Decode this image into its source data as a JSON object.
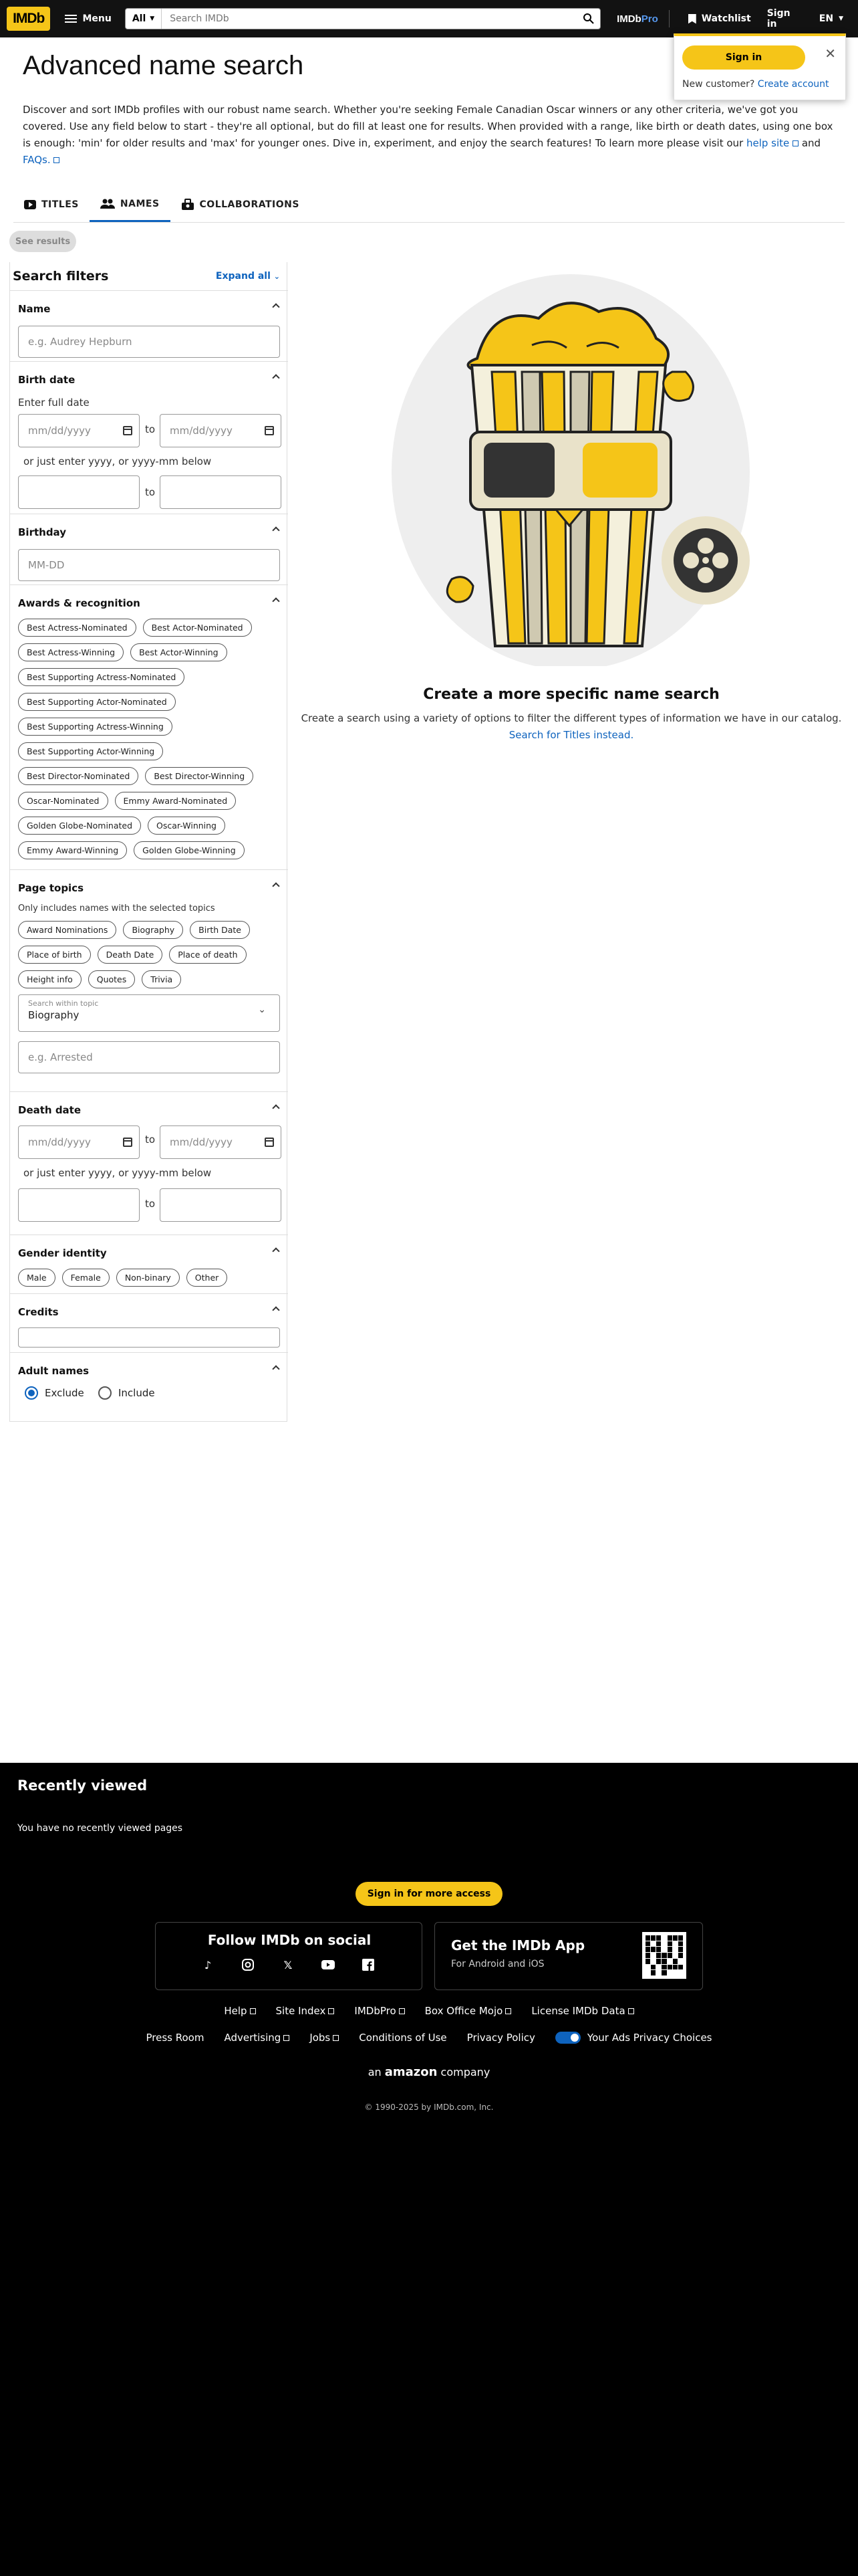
{
  "topbar": {
    "logo": "IMDb",
    "menu_label": "Menu",
    "search_category": "All",
    "search_placeholder": "Search IMDb",
    "pro_a": "IMDb",
    "pro_b": "Pro",
    "watchlist": "Watchlist",
    "signin": "Sign in",
    "language": "EN"
  },
  "popover": {
    "signin_button": "Sign in",
    "new_customer": "New customer?",
    "create_account": "Create account"
  },
  "page": {
    "title": "Advanced name search",
    "intro": "Discover and sort IMDb profiles with our robust name search. Whether you're seeking Female Canadian Oscar winners or any other criteria, we've got you covered. Use any field below to start - they're all optional, but do fill at least one for results. When provided with a range, like birth or death dates, using one box is enough: 'min' for older results and 'max' for younger ones. Dive in, experiment, and enjoy the search features! To learn more please visit our ",
    "help_link": "help site",
    "and": " and ",
    "faqs_link": "FAQs.",
    "see_results": "See results"
  },
  "tabs": [
    {
      "label": "TITLES",
      "icon": "movie-icon"
    },
    {
      "label": "NAMES",
      "icon": "people-icon"
    },
    {
      "label": "COLLABORATIONS",
      "icon": "collaboration-icon"
    }
  ],
  "filters": {
    "heading": "Search filters",
    "expand_all": "Expand all",
    "name": {
      "title": "Name",
      "placeholder": "e.g. Audrey Hepburn"
    },
    "birth_date": {
      "title": "Birth date",
      "enter_full": "Enter full date",
      "date_placeholder": "mm/dd/yyyy",
      "to": "to",
      "or_just": "or just enter yyyy, or yyyy-mm below"
    },
    "birthday": {
      "title": "Birthday",
      "placeholder": "MM-DD"
    },
    "awards": {
      "title": "Awards & recognition",
      "chips": [
        "Best Actress-Nominated",
        "Best Actor-Nominated",
        "Best Actress-Winning",
        "Best Actor-Winning",
        "Best Supporting Actress-Nominated",
        "Best Supporting Actor-Nominated",
        "Best Supporting Actress-Winning",
        "Best Supporting Actor-Winning",
        "Best Director-Nominated",
        "Best Director-Winning",
        "Oscar-Nominated",
        "Emmy Award-Nominated",
        "Golden Globe-Nominated",
        "Oscar-Winning",
        "Emmy Award-Winning",
        "Golden Globe-Winning"
      ]
    },
    "page_topics": {
      "title": "Page topics",
      "note": "Only includes names with the selected topics",
      "chips": [
        "Award Nominations",
        "Biography",
        "Birth Date",
        "Place of birth",
        "Death Date",
        "Place of death",
        "Height info",
        "Quotes",
        "Trivia"
      ],
      "select_label": "Search within topic",
      "select_value": "Biography",
      "text_placeholder": "e.g. Arrested"
    },
    "death_date": {
      "title": "Death date",
      "date_placeholder": "mm/dd/yyyy",
      "to": "to",
      "or_just": "or just enter yyyy, or yyyy-mm below"
    },
    "gender": {
      "title": "Gender identity",
      "chips": [
        "Male",
        "Female",
        "Non-binary",
        "Other"
      ]
    },
    "credits": {
      "title": "Credits"
    },
    "adult": {
      "title": "Adult names",
      "exclude": "Exclude",
      "include": "Include"
    }
  },
  "hero": {
    "title": "Create a more specific name search",
    "subtitle": "Create a search using a variety of options to filter the different types of information we have in our catalog.",
    "link": "Search for Titles instead."
  },
  "footer": {
    "recently_viewed": "Recently viewed",
    "no_recent": "You have no recently viewed pages",
    "signin_more": "Sign in for more access",
    "follow": "Follow IMDb on social",
    "app_title": "Get the IMDb App",
    "app_sub": "For Android and iOS",
    "links1": [
      "Help",
      "Site Index",
      "IMDbPro",
      "Box Office Mojo",
      "License IMDb Data"
    ],
    "links2": [
      "Press Room",
      "Advertising",
      "Jobs",
      "Conditions of Use",
      "Privacy Policy",
      "Your Ads Privacy Choices"
    ],
    "an": "an",
    "amazon": "amazon",
    "company": "company",
    "copyright": "© 1990-2025 by IMDb.com, Inc."
  },
  "colors": {
    "brand": "#f5c518",
    "link": "#0e63be",
    "footer_bg": "#000000"
  }
}
